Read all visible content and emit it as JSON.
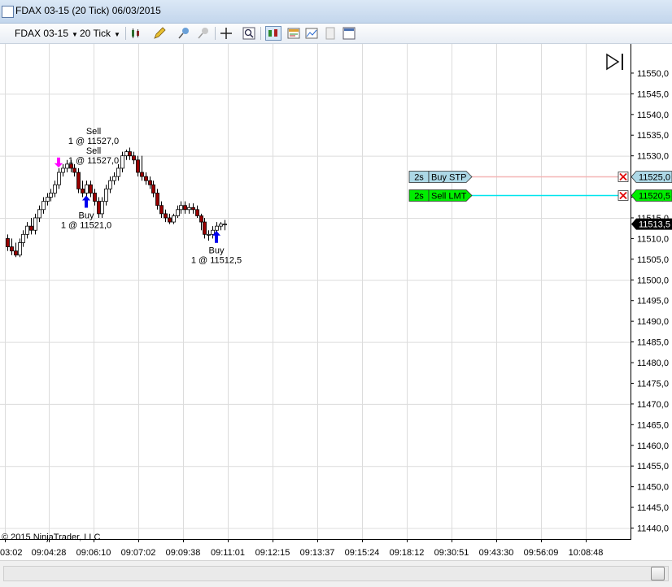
{
  "window": {
    "title": "FDAX 03-15 (20 Tick)  06/03/2015"
  },
  "toolbar": {
    "instrument": "FDAX 03-15",
    "interval": "20 Tick"
  },
  "icons": [
    "chart-icon",
    "candlestick-style-icon",
    "pencil-draw-icon",
    "pin-icon",
    "crosshair-icon",
    "zoom-icon",
    "chart-trader-icon",
    "data-box-icon",
    "template-icon",
    "properties-icon",
    "scroll-to-end-icon"
  ],
  "colors": {
    "bull_candle": "#ffffff",
    "bear_candle": "#990000",
    "buy_stop": "#add8e6",
    "sell_limit": "#00ee00",
    "stop_line": "#f4b4b4",
    "limit_line": "#00e5ee",
    "buy_arrow": "#0000ee",
    "sell_arrow": "#ff00ff"
  },
  "chart_data": {
    "type": "candlestick",
    "title": "FDAX 03-15 (20 Tick)  06/03/2015",
    "copyright": "© 2015 NinjaTrader, LLC",
    "ylim": [
      11437.5,
      11555.0
    ],
    "y_ticks": [
      "11440,0",
      "11445,0",
      "11450,0",
      "11455,0",
      "11460,0",
      "11465,0",
      "11470,0",
      "11475,0",
      "11480,0",
      "11485,0",
      "11490,0",
      "11495,0",
      "11500,0",
      "11505,0",
      "11510,0",
      "11515,0",
      "11520,0",
      "11525,0",
      "11530,0",
      "11535,0",
      "11540,0",
      "11545,0",
      "11550,0"
    ],
    "x_ticks": [
      "03:02",
      "09:04:28",
      "09:06:10",
      "09:07:02",
      "09:09:38",
      "09:11:01",
      "09:12:15",
      "09:13:37",
      "09:15:24",
      "09:18:12",
      "09:30:51",
      "09:43:30",
      "09:56:09",
      "10:08:48"
    ],
    "last_price": "11513,5",
    "candles": [
      {
        "o": 11510,
        "h": 11511,
        "l": 11507,
        "c": 11508
      },
      {
        "o": 11508,
        "h": 11510,
        "l": 11506,
        "c": 11507
      },
      {
        "o": 11507,
        "h": 11509,
        "l": 11505.5,
        "c": 11506
      },
      {
        "o": 11506,
        "h": 11510,
        "l": 11505.5,
        "c": 11509
      },
      {
        "o": 11509,
        "h": 11512,
        "l": 11508,
        "c": 11511
      },
      {
        "o": 11511,
        "h": 11514,
        "l": 11510,
        "c": 11513
      },
      {
        "o": 11513,
        "h": 11515,
        "l": 11511,
        "c": 11512
      },
      {
        "o": 11512,
        "h": 11516,
        "l": 11511,
        "c": 11515
      },
      {
        "o": 11515,
        "h": 11518,
        "l": 11514,
        "c": 11517
      },
      {
        "o": 11517,
        "h": 11520,
        "l": 11516,
        "c": 11519
      },
      {
        "o": 11519,
        "h": 11521,
        "l": 11518,
        "c": 11520
      },
      {
        "o": 11520,
        "h": 11522,
        "l": 11519,
        "c": 11521
      },
      {
        "o": 11521,
        "h": 11524,
        "l": 11520,
        "c": 11523
      },
      {
        "o": 11523,
        "h": 11527,
        "l": 11522,
        "c": 11526
      },
      {
        "o": 11526,
        "h": 11528,
        "l": 11525,
        "c": 11527
      },
      {
        "o": 11527,
        "h": 11529,
        "l": 11526,
        "c": 11528
      },
      {
        "o": 11528,
        "h": 11529,
        "l": 11526,
        "c": 11527
      },
      {
        "o": 11527,
        "h": 11528,
        "l": 11525,
        "c": 11526
      },
      {
        "o": 11526,
        "h": 11527,
        "l": 11521,
        "c": 11522
      },
      {
        "o": 11522,
        "h": 11524,
        "l": 11520,
        "c": 11521
      },
      {
        "o": 11521,
        "h": 11524,
        "l": 11520,
        "c": 11523
      },
      {
        "o": 11523,
        "h": 11524,
        "l": 11520,
        "c": 11521
      },
      {
        "o": 11521,
        "h": 11522,
        "l": 11518,
        "c": 11519
      },
      {
        "o": 11519,
        "h": 11520,
        "l": 11515,
        "c": 11516
      },
      {
        "o": 11516,
        "h": 11520,
        "l": 11515,
        "c": 11519
      },
      {
        "o": 11519,
        "h": 11523,
        "l": 11518,
        "c": 11522
      },
      {
        "o": 11522,
        "h": 11525,
        "l": 11521,
        "c": 11524
      },
      {
        "o": 11524,
        "h": 11526,
        "l": 11523,
        "c": 11525
      },
      {
        "o": 11525,
        "h": 11528,
        "l": 11524,
        "c": 11527
      },
      {
        "o": 11527,
        "h": 11531,
        "l": 11526,
        "c": 11530
      },
      {
        "o": 11530,
        "h": 11531.5,
        "l": 11529,
        "c": 11531
      },
      {
        "o": 11531,
        "h": 11532,
        "l": 11529,
        "c": 11530
      },
      {
        "o": 11530,
        "h": 11531,
        "l": 11528,
        "c": 11529
      },
      {
        "o": 11529,
        "h": 11530,
        "l": 11525,
        "c": 11526
      },
      {
        "o": 11526,
        "h": 11530,
        "l": 11524,
        "c": 11525
      },
      {
        "o": 11525,
        "h": 11526,
        "l": 11523,
        "c": 11524
      },
      {
        "o": 11524,
        "h": 11525,
        "l": 11522,
        "c": 11523
      },
      {
        "o": 11523,
        "h": 11524,
        "l": 11520,
        "c": 11521
      },
      {
        "o": 11521,
        "h": 11522,
        "l": 11517,
        "c": 11518
      },
      {
        "o": 11518,
        "h": 11519,
        "l": 11515,
        "c": 11516
      },
      {
        "o": 11516,
        "h": 11517,
        "l": 11514,
        "c": 11515
      },
      {
        "o": 11515,
        "h": 11516,
        "l": 11513.5,
        "c": 11514
      },
      {
        "o": 11514,
        "h": 11516,
        "l": 11513.5,
        "c": 11515.5
      },
      {
        "o": 11515.5,
        "h": 11518,
        "l": 11515,
        "c": 11517
      },
      {
        "o": 11517,
        "h": 11519,
        "l": 11516,
        "c": 11518
      },
      {
        "o": 11518,
        "h": 11519,
        "l": 11516,
        "c": 11517
      },
      {
        "o": 11517,
        "h": 11518.5,
        "l": 11516,
        "c": 11517.5
      },
      {
        "o": 11517.5,
        "h": 11518.5,
        "l": 11516,
        "c": 11517
      },
      {
        "o": 11517,
        "h": 11518,
        "l": 11515,
        "c": 11515.5
      },
      {
        "o": 11515.5,
        "h": 11516,
        "l": 11512,
        "c": 11514
      },
      {
        "o": 11514,
        "h": 11515,
        "l": 11510,
        "c": 11511
      },
      {
        "o": 11511,
        "h": 11512,
        "l": 11509.5,
        "c": 11511
      },
      {
        "o": 11511,
        "h": 11513,
        "l": 11510,
        "c": 11512
      },
      {
        "o": 11512,
        "h": 11514,
        "l": 11511,
        "c": 11513
      },
      {
        "o": 11513,
        "h": 11514,
        "l": 11512,
        "c": 11513.5
      },
      {
        "o": 11513.5,
        "h": 11514.5,
        "l": 11512,
        "c": 11513.5
      }
    ],
    "executions": [
      {
        "side": "Sell",
        "label": "Sell",
        "fill": "1 @ 11527,0",
        "bar": 13,
        "price": 11527.0
      },
      {
        "side": "Sell",
        "label": "Sell",
        "fill": "1 @ 11527,0",
        "bar": 13,
        "price": 11527.0
      },
      {
        "side": "Buy",
        "label": "Buy",
        "fill": "1 @ 11521,0",
        "bar": 20,
        "price": 11521.0
      },
      {
        "side": "Buy",
        "label": "Buy",
        "fill": "1 @ 11512,5",
        "bar": 53,
        "price": 11512.5
      }
    ],
    "orders": [
      {
        "qty": "2s",
        "label": "Buy STP",
        "price": 11525.0,
        "price_label": "11525,0"
      },
      {
        "qty": "2s",
        "label": "Sell LMT",
        "price": 11520.5,
        "price_label": "11520,5"
      }
    ]
  }
}
